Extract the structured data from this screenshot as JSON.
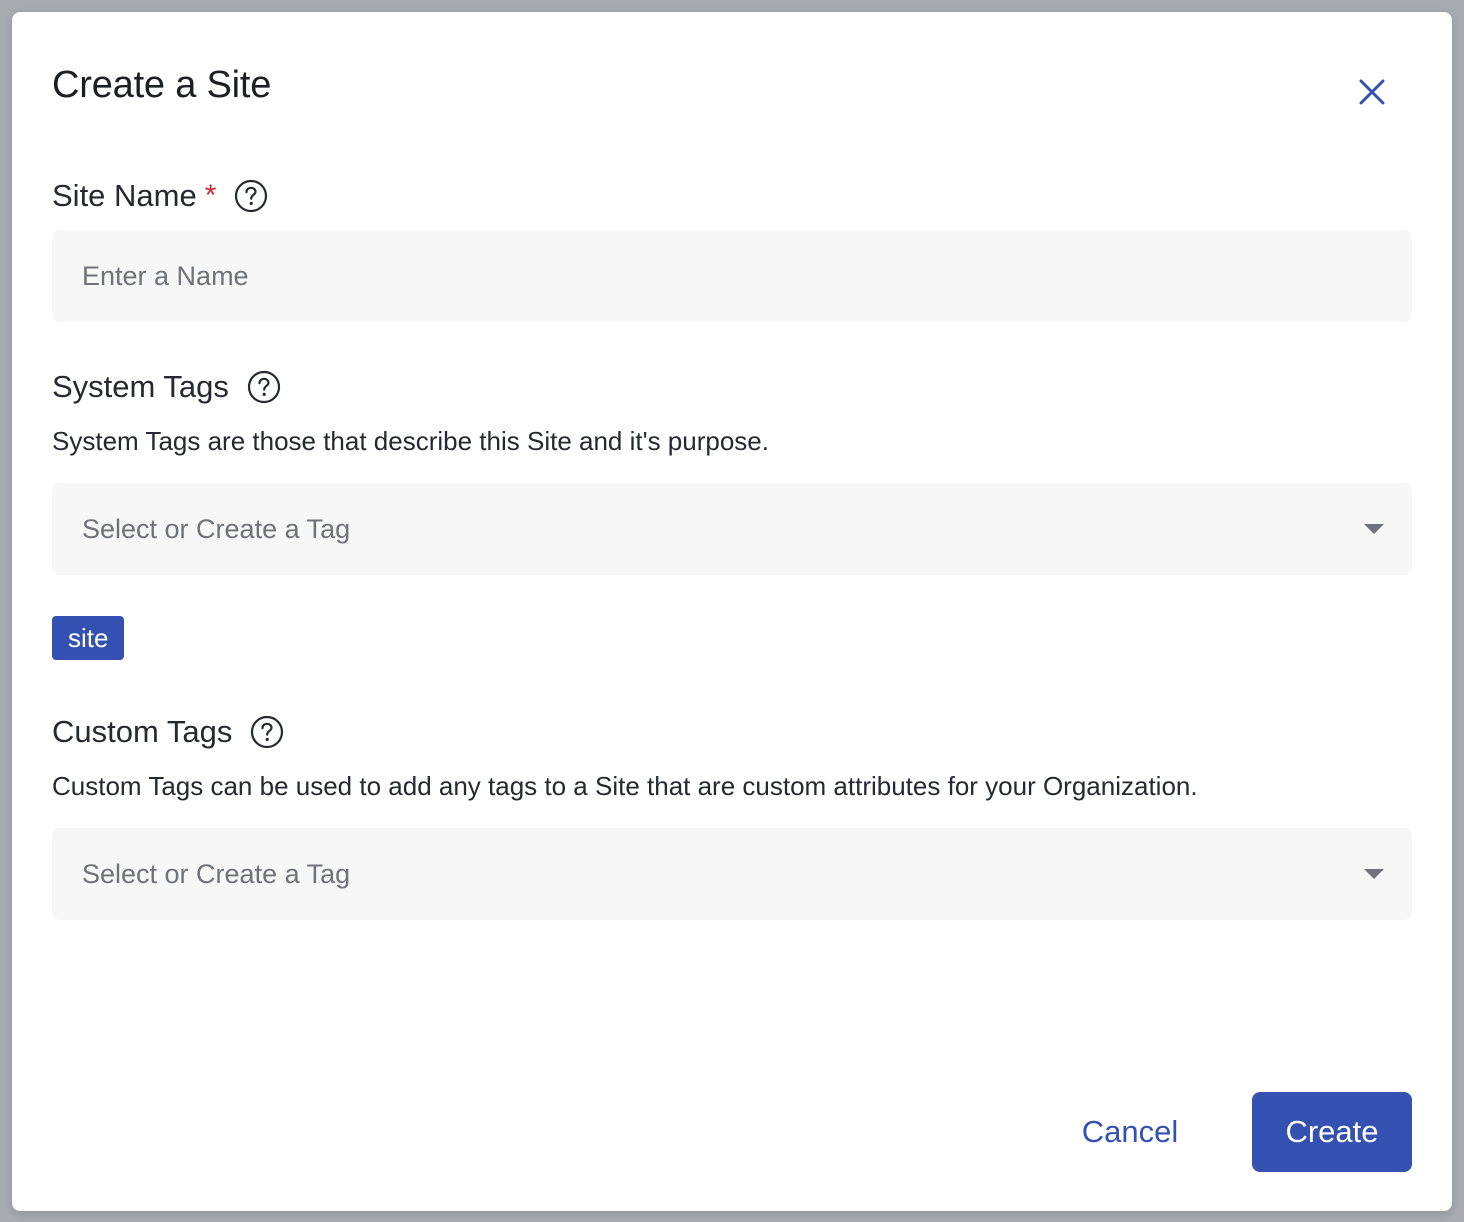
{
  "modal": {
    "title": "Create a Site",
    "close_icon": "close-icon"
  },
  "site_name": {
    "label": "Site Name",
    "required_mark": "*",
    "help_icon": "help-circle-icon",
    "placeholder": "Enter a Name",
    "value": ""
  },
  "system_tags": {
    "label": "System Tags",
    "help_icon": "help-circle-icon",
    "description": "System Tags are those that describe this Site and it's purpose.",
    "placeholder": "Select or Create a Tag",
    "dropdown_icon": "caret-down-icon",
    "selected": [
      "site"
    ]
  },
  "custom_tags": {
    "label": "Custom Tags",
    "help_icon": "help-circle-icon",
    "description": "Custom Tags can be used to add any tags to a Site that are custom attributes for your Organization.",
    "placeholder": "Select or Create a Tag",
    "dropdown_icon": "caret-down-icon"
  },
  "footer": {
    "cancel_label": "Cancel",
    "create_label": "Create"
  },
  "colors": {
    "primary": "#3451b2",
    "required": "#d02b2b",
    "field_bg": "#f7f7f7",
    "overlay": "#a7abb0"
  }
}
